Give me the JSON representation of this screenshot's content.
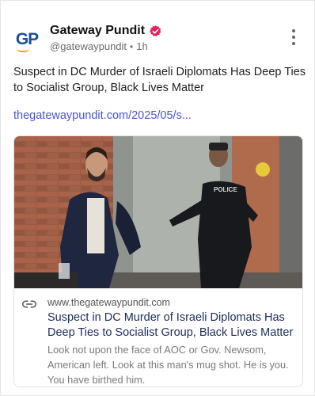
{
  "author": {
    "avatar_text": "GP",
    "name": "Gateway Pundit",
    "handle": "@gatewaypundit",
    "separator": "•",
    "time": "1h"
  },
  "icons": {
    "verified": "verified-badge-icon",
    "more": "more-vertical-icon",
    "link": "link-icon"
  },
  "colors": {
    "verified": "#e0245e",
    "link": "#4a55d6",
    "brand_blue": "#1b4f9c",
    "brand_orange": "#f2a51a"
  },
  "post": {
    "text": "Suspect in DC Murder of Israeli Diplomats Has Deep Ties to Socialist Group, Black Lives Matter",
    "link": "thegatewaypundit.com/2025/05/s..."
  },
  "link_card": {
    "image_overlay_text": "POLICE",
    "domain": "www.thegatewaypundit.com",
    "title": "Suspect in DC Murder of Israeli Diplomats Has Deep Ties to Socialist Group, Black Lives Matter",
    "description": "Look not upon the face of AOC or Gov. Newsom, American left. Look at this man's mug shot. He is you. You have birthed him."
  }
}
